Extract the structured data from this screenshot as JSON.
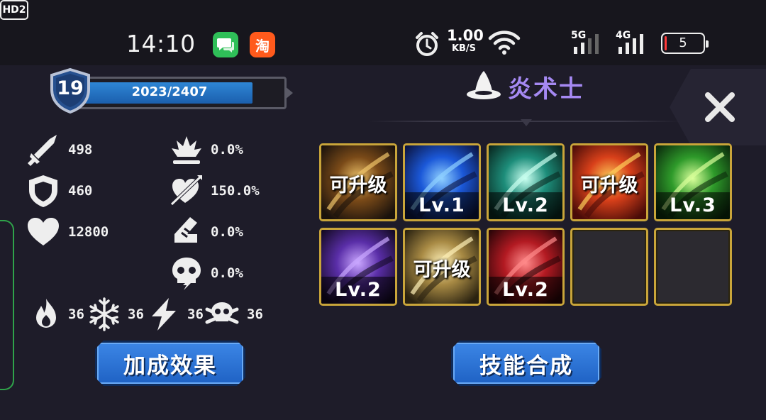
{
  "status_bar": {
    "time": "14:10",
    "apps": [
      {
        "name": "wechat-icon",
        "glyph": ""
      },
      {
        "name": "taobao-icon",
        "glyph": "淘"
      }
    ],
    "net_speed_value": "1.00",
    "net_speed_unit": "KB/S",
    "hd_label": "HD2",
    "signal1_label": "5G",
    "signal2_label": "4G",
    "battery": "5"
  },
  "player": {
    "level": "19",
    "xp_text": "2023/2407",
    "xp_current": 2023,
    "xp_max": 2407
  },
  "stats": {
    "attack": "498",
    "defense": "460",
    "health": "12800",
    "crit_rate": "0.0%",
    "crit_damage": "150.0%",
    "dodge": "0.0%",
    "stun": "0.0%"
  },
  "resistances": {
    "fire": "36",
    "ice": "36",
    "lightning": "36",
    "poison": "36"
  },
  "class": {
    "name": "炎术士"
  },
  "skills": [
    {
      "label": "可升级",
      "type": "upgrade",
      "palette": "gold"
    },
    {
      "label": "Lv.1",
      "type": "level",
      "palette": "blue"
    },
    {
      "label": "Lv.2",
      "type": "level",
      "palette": "teal"
    },
    {
      "label": "可升级",
      "type": "upgrade",
      "palette": "fire"
    },
    {
      "label": "Lv.3",
      "type": "level",
      "palette": "green"
    },
    {
      "label": "Lv.2",
      "type": "level",
      "palette": "purple"
    },
    {
      "label": "可升级",
      "type": "upgrade",
      "palette": "sand"
    },
    {
      "label": "Lv.2",
      "type": "level",
      "palette": "red"
    },
    {
      "label": "",
      "type": "empty",
      "palette": ""
    },
    {
      "label": "",
      "type": "empty",
      "palette": ""
    }
  ],
  "buttons": {
    "bonus_label": "加成效果",
    "synthesis_label": "技能合成"
  },
  "colors": {
    "class_name": "#a589f2",
    "skill_frame": "#c9a53a",
    "button_blue": "#2f75d6"
  }
}
